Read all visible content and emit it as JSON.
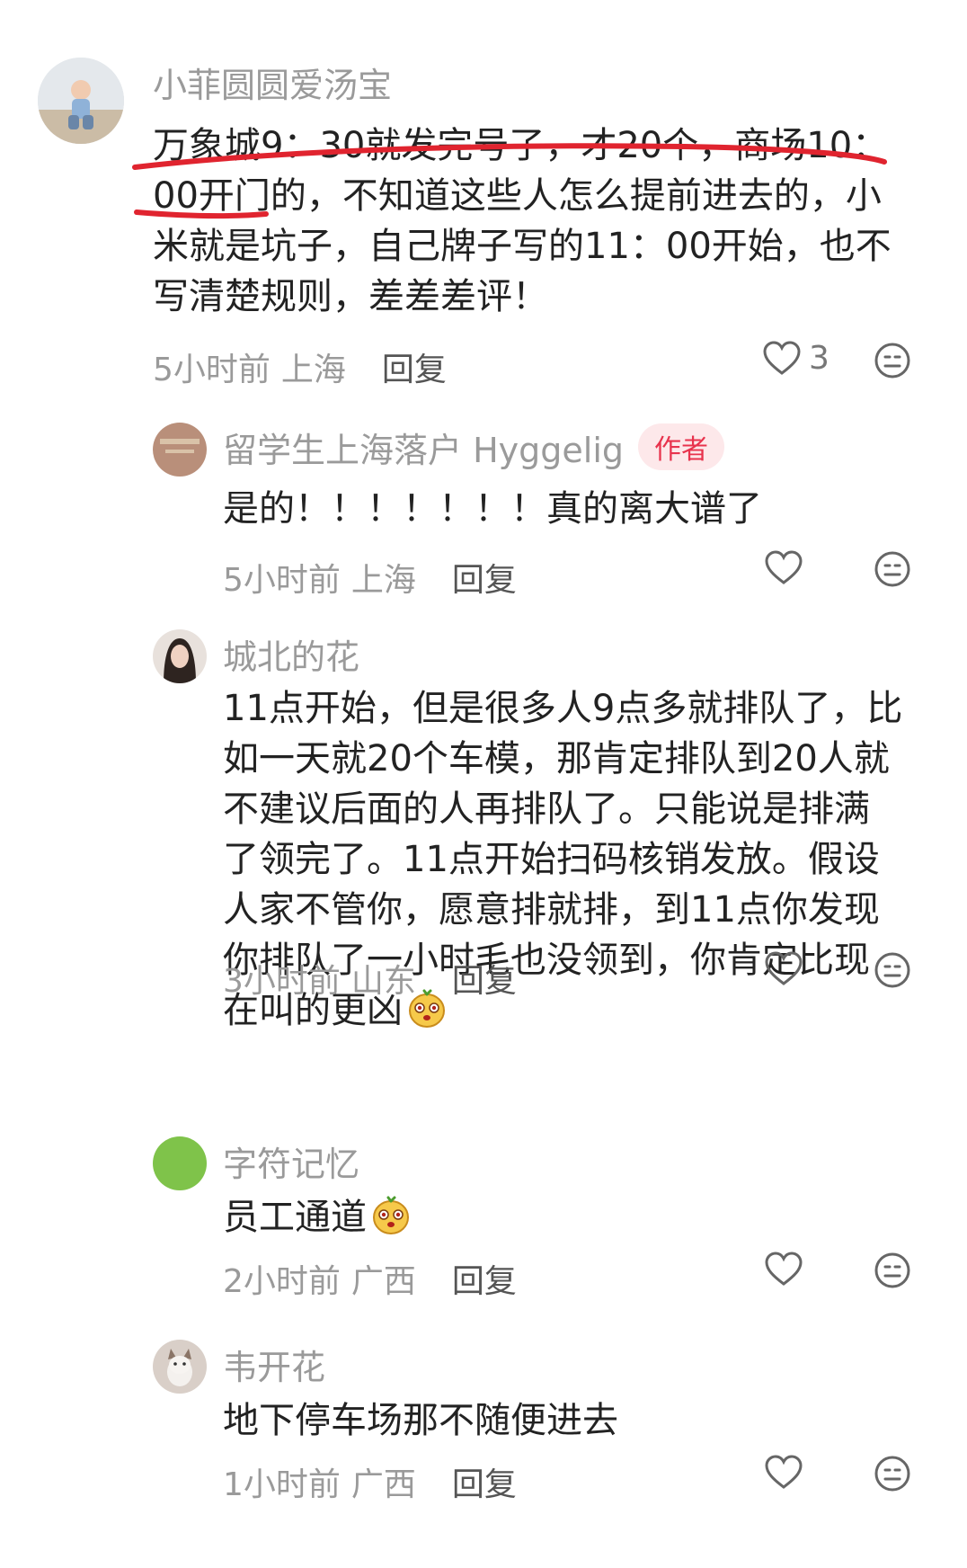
{
  "comments": [
    {
      "username": "小菲圆圆爱汤宝",
      "lines": [
        "万象城9：30就发完号了，才20个，商场10：",
        "00开门的，不知道这些人怎么提前进去的，小",
        "米就是坑子，自己牌子写的11：00开始，也不",
        "写清楚规则，差差差评！"
      ],
      "time": "5小时前",
      "location": "上海",
      "reply_label": "回复",
      "like_count": "3"
    }
  ],
  "replies": [
    {
      "username": "留学生上海落户 Hyggelig",
      "badge": "作者",
      "lines": [
        "是的！！！！！！！真的离大谱了"
      ],
      "time": "5小时前",
      "location": "上海",
      "reply_label": "回复"
    },
    {
      "username": "城北的花",
      "lines": [
        "11点开始，但是很多人9点多就排队了，比",
        "如一天就20个车模，那肯定排队到20人就",
        "不建议后面的人再排队了。只能说是排满",
        "了领完了。11点开始扫码核销发放。假设",
        "人家不管你，愿意排就排，到11点你发现",
        "你排队了一小时毛也没领到，你肯定比现",
        "在叫的更凶"
      ],
      "time": "3小时前",
      "location": "山东",
      "reply_label": "回复"
    },
    {
      "username": "字符记忆",
      "lines": [
        "员工通道"
      ],
      "time": "2小时前",
      "location": "广西",
      "reply_label": "回复"
    },
    {
      "username": "韦开花",
      "lines": [
        "地下停车场那不随便进去"
      ],
      "time": "1小时前",
      "location": "广西",
      "reply_label": "回复"
    }
  ],
  "colors": {
    "username": "#9a9a9a",
    "meta": "#9a9a9a",
    "reply_button": "#555555",
    "author_badge_bg": "#fde8ea",
    "author_badge_text": "#e8334d",
    "annotation_red": "#e0242f",
    "body_text": "#222222"
  },
  "icons": [
    "heart-icon",
    "dislike-face-icon",
    "emoji-face-icon"
  ]
}
